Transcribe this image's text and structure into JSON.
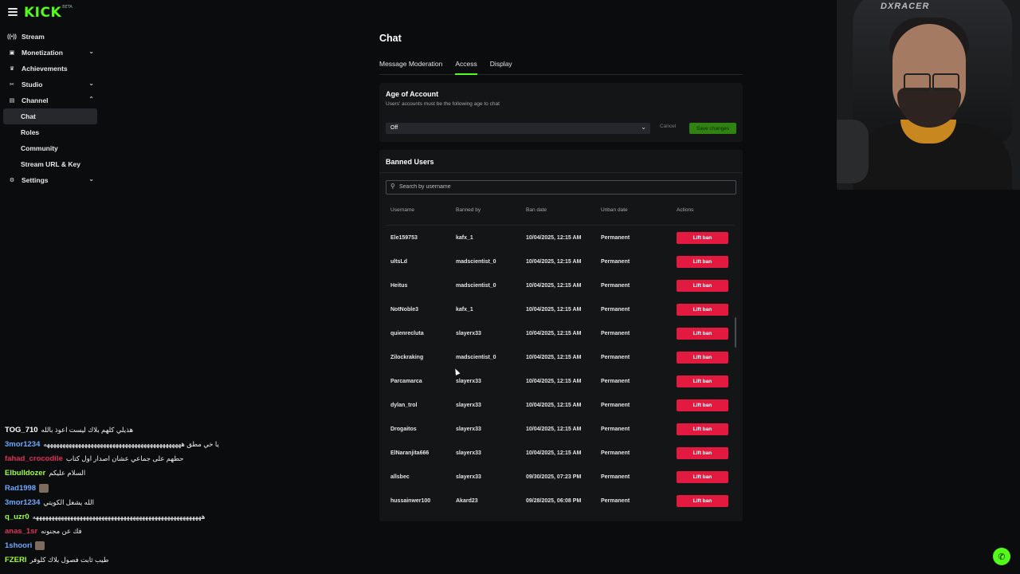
{
  "brand": {
    "logo": "KICK",
    "logo_sup": "BETA",
    "accent": "#53fc18"
  },
  "sidebar": {
    "items": [
      {
        "label": "Stream",
        "icon": "broadcast-icon",
        "chevron": ""
      },
      {
        "label": "Monetization",
        "icon": "dollar-icon",
        "chevron": "down"
      },
      {
        "label": "Achievements",
        "icon": "trophy-icon",
        "chevron": ""
      },
      {
        "label": "Studio",
        "icon": "studio-icon",
        "chevron": "down"
      },
      {
        "label": "Channel",
        "icon": "channel-icon",
        "chevron": "up"
      },
      {
        "label": "Chat",
        "sub": true,
        "active": true
      },
      {
        "label": "Roles",
        "sub": true
      },
      {
        "label": "Community",
        "sub": true
      },
      {
        "label": "Stream URL & Key",
        "sub": true
      },
      {
        "label": "Settings",
        "icon": "gear-icon",
        "chevron": "down"
      }
    ]
  },
  "main": {
    "title": "Chat",
    "tabs": [
      "Message Moderation",
      "Access",
      "Display"
    ],
    "active_tab": "Access",
    "age_card": {
      "title": "Age of Account",
      "subtitle": "Users' accounts must be the following age to chat",
      "select_value": "Off",
      "cancel_label": "Cancel",
      "save_label": "Save changes"
    },
    "banned": {
      "title": "Banned Users",
      "search_placeholder": "Search by username",
      "columns": [
        "Username",
        "Banned by",
        "Ban date",
        "Unban date",
        "Actions"
      ],
      "action_label": "Lift ban",
      "rows": [
        [
          "Ele159753",
          "kafx_1",
          "10/04/2025, 12:15 AM",
          "Permanent"
        ],
        [
          "ultsLd",
          "madscientist_0",
          "10/04/2025, 12:15 AM",
          "Permanent"
        ],
        [
          "Heitus",
          "madscientist_0",
          "10/04/2025, 12:15 AM",
          "Permanent"
        ],
        [
          "NotNoble3",
          "kafx_1",
          "10/04/2025, 12:15 AM",
          "Permanent"
        ],
        [
          "quienrecluta",
          "slayerx33",
          "10/04/2025, 12:15 AM",
          "Permanent"
        ],
        [
          "Zilockraking",
          "madscientist_0",
          "10/04/2025, 12:15 AM",
          "Permanent"
        ],
        [
          "Parcamarca",
          "slayerx33",
          "10/04/2025, 12:15 AM",
          "Permanent"
        ],
        [
          "dylan_trol",
          "slayerx33",
          "10/04/2025, 12:15 AM",
          "Permanent"
        ],
        [
          "Drogaitos",
          "slayerx33",
          "10/04/2025, 12:15 AM",
          "Permanent"
        ],
        [
          "ElNaranjita666",
          "slayerx33",
          "10/04/2025, 12:15 AM",
          "Permanent"
        ],
        [
          "allsbec",
          "slayerx33",
          "09/30/2025, 07:23 PM",
          "Permanent"
        ],
        [
          "hussainwer100",
          "Akard23",
          "09/28/2025, 06:08 PM",
          "Permanent"
        ]
      ]
    }
  },
  "webcam": {
    "chair_brand": "DXRACER"
  },
  "chat_overlay": [
    {
      "user": "",
      "color": "#9ab3ff",
      "text": "",
      "emote": false,
      "fade": true
    },
    {
      "user": "TOG_710",
      "color": "#ffffff",
      "text": "هذيلي كلهم بلاك ليست اعوذ بالله",
      "emote": false
    },
    {
      "user": "3mor1234",
      "color": "#6fa8ff",
      "text": "يا خي مطق ههههههههههههههههههههههههههههههههههههههههههههه",
      "emote": false
    },
    {
      "user": "fahad_crocodile",
      "color": "#e0315c",
      "text": "حطهم على جماعي عشان اصدار اول كتاب",
      "emote": false
    },
    {
      "user": "Elbulldozer",
      "color": "#9fff3a",
      "text": "السلام عليكم",
      "emote": false
    },
    {
      "user": "Rad1998",
      "color": "#6fa8ff",
      "text": "",
      "emote": true
    },
    {
      "user": "3mor1234",
      "color": "#6fa8ff",
      "text": "الله يشغل الكويتي",
      "emote": false
    },
    {
      "user": "q_uzr0",
      "color": "#9fff3a",
      "text": "ههههههههههههههههههههههههههههههههههههههههههههههههههههههه",
      "emote": false
    },
    {
      "user": "anas_1sr",
      "color": "#e0315c",
      "text": "فك عن مجنونه",
      "emote": false
    },
    {
      "user": "1shoori",
      "color": "#6fa8ff",
      "text": "",
      "emote": true
    },
    {
      "user": "FZERI",
      "color": "#9fff3a",
      "text": "طيب ثابت فصول بلاك كلوفر",
      "emote": false
    }
  ]
}
